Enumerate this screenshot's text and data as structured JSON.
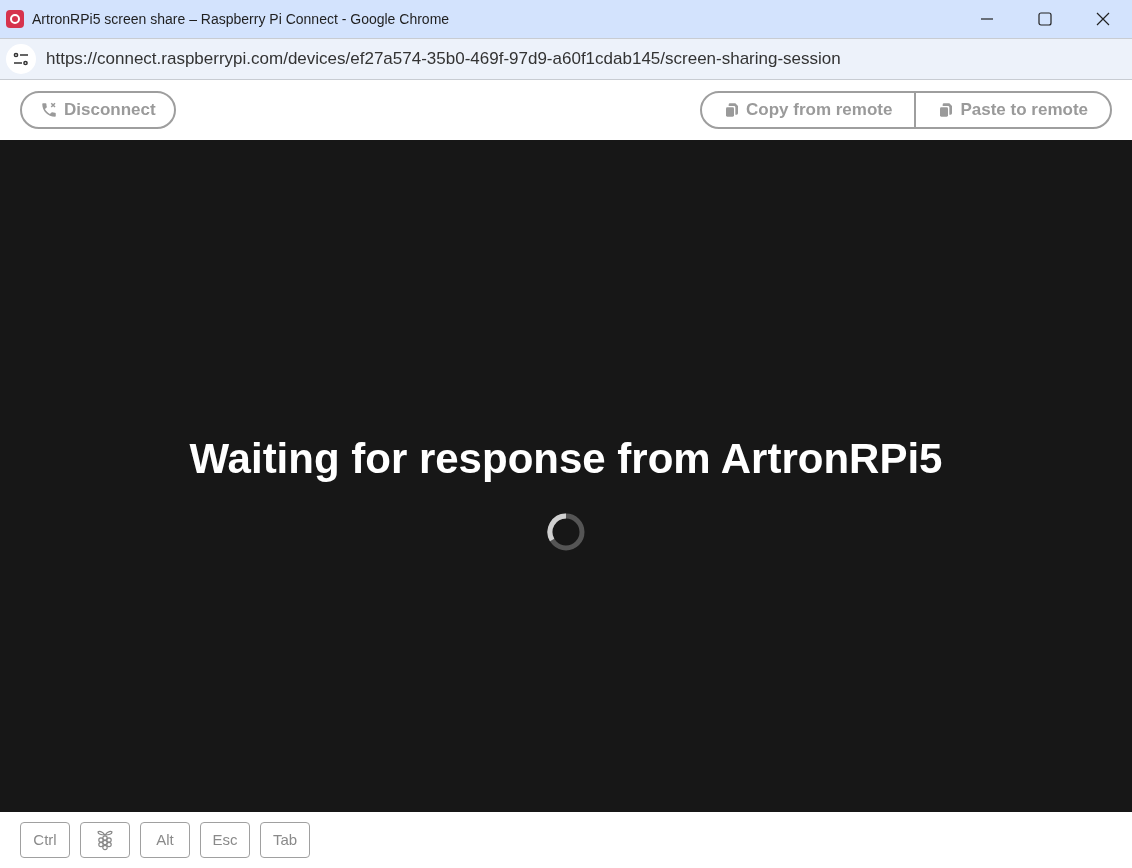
{
  "window": {
    "title": "ArtronRPi5 screen share – Raspberry Pi Connect - Google Chrome"
  },
  "address_bar": {
    "url": "https://connect.raspberrypi.com/devices/ef27a574-35b0-469f-97d9-a60f1cdab145/screen-sharing-session"
  },
  "toolbar": {
    "disconnect": {
      "label": "Disconnect",
      "disabled": true
    },
    "clipboard": [
      {
        "label": "Copy from remote",
        "disabled": true
      },
      {
        "label": "Paste to remote",
        "disabled": true
      }
    ]
  },
  "screen": {
    "message": "Waiting for response from ArtronRPi5",
    "loading": true
  },
  "keys": [
    {
      "kind": "text",
      "label": "Ctrl"
    },
    {
      "kind": "logo"
    },
    {
      "kind": "text",
      "label": "Alt"
    },
    {
      "kind": "text",
      "label": "Esc"
    },
    {
      "kind": "text",
      "label": "Tab"
    }
  ]
}
